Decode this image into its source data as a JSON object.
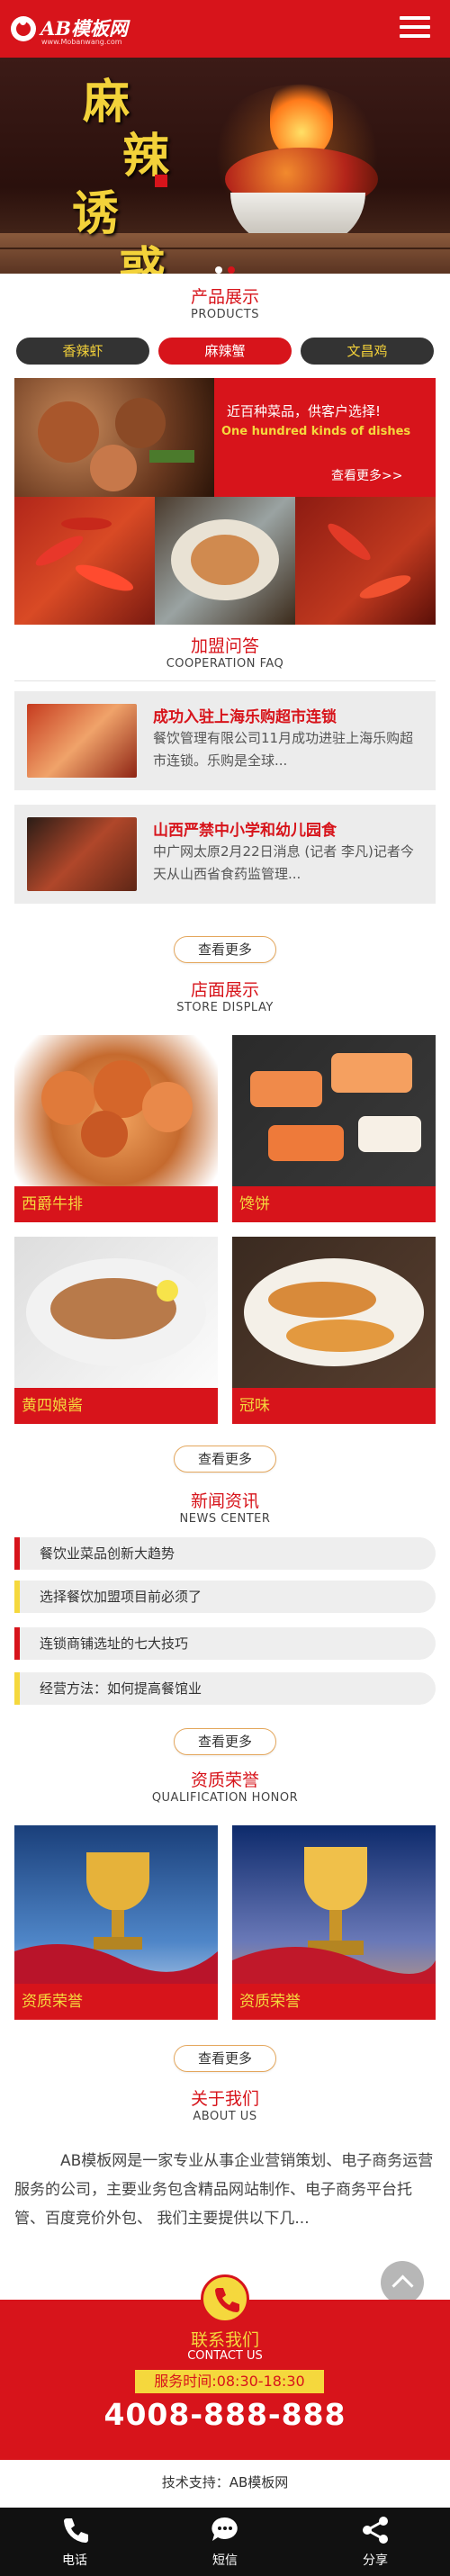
{
  "header": {
    "logo_text": "AB模板网",
    "logo_sub": "www.Mobanwang.com"
  },
  "banner": {
    "line1": "麻",
    "line2": "辣",
    "line3": "诱",
    "line4": "惑"
  },
  "products": {
    "title_cn": "产品展示",
    "title_en": "PRODUCTS",
    "categories": [
      "香辣虾",
      "麻辣蟹",
      "文昌鸡"
    ],
    "active_category": 1,
    "promo": {
      "line1": "近百种菜品，供客户选择!",
      "line2": "One hundred kinds of dishes",
      "more": "查看更多>>"
    }
  },
  "faq": {
    "title_cn": "加盟问答",
    "title_en": "COOPERATION FAQ",
    "items": [
      {
        "title": "成功入驻上海乐购超市连锁",
        "desc": "餐饮管理有限公司11月成功进驻上海乐购超市连锁。乐购是全球..."
      },
      {
        "title": "山西严禁中小学和幼儿园食",
        "desc": "中广网太原2月22日消息 (记者 李凡)记者今天从山西省食药监管理..."
      }
    ],
    "more": "查看更多"
  },
  "store": {
    "title_cn": "店面展示",
    "title_en": "STORE DISPLAY",
    "items": [
      "西爵牛排",
      "馋饼",
      "黄四娘酱",
      "冠味"
    ],
    "more": "查看更多"
  },
  "news": {
    "title_cn": "新闻资讯",
    "title_en": "NEWS CENTER",
    "items": [
      "餐饮业菜品创新大趋势",
      "选择餐饮加盟项目前必须了",
      "连锁商铺选址的七大技巧",
      "经营方法：如何提高餐馆业"
    ],
    "bar_colors": [
      "#d7141b",
      "#f5d83d",
      "#d7141b",
      "#f5d83d"
    ],
    "more": "查看更多"
  },
  "honor": {
    "title_cn": "资质荣誉",
    "title_en": "QUALIFICATION HONOR",
    "items": [
      "资质荣誉",
      "资质荣誉"
    ],
    "more": "查看更多"
  },
  "about": {
    "title_cn": "关于我们",
    "title_en": "ABOUT US",
    "text": "AB模板网是一家专业从事企业营销策划、电子商务运营服务的公司，主要业务包含精品网站制作、电子商务平台托管、百度竞价外包、 我们主要提供以下几..."
  },
  "contact": {
    "title_cn": "联系我们",
    "title_en": "CONTACT US",
    "hours": "服务时间:08:30-18:30",
    "phone": "4008-888-888"
  },
  "support": "技术支持：AB模板网",
  "bottom_tabs": [
    {
      "label": "电话",
      "icon": "phone-icon"
    },
    {
      "label": "短信",
      "icon": "message-icon"
    },
    {
      "label": "分享",
      "icon": "share-icon"
    }
  ],
  "colors": {
    "brand_red": "#d7141b",
    "accent_yellow": "#f5d83d",
    "dark": "#111111"
  }
}
